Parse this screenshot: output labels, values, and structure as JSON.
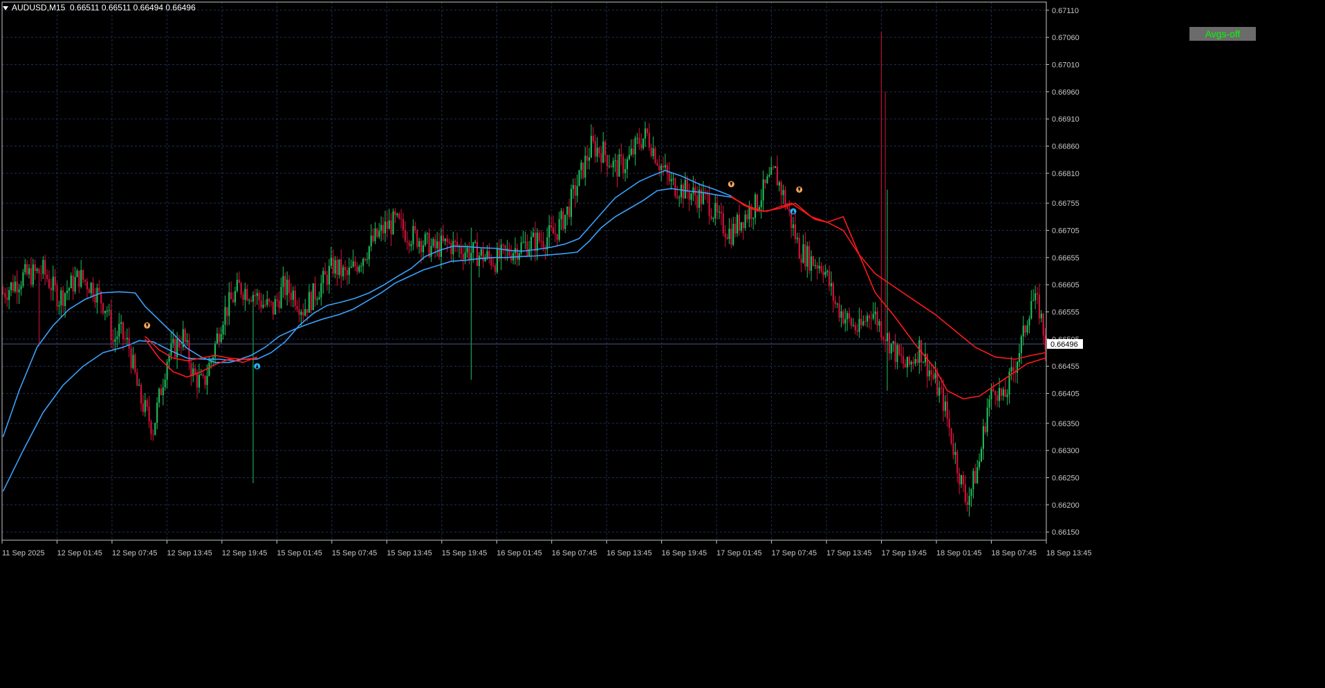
{
  "header": {
    "symbol": "AUDUSD,M15",
    "ohlc": "0.66511 0.66511 0.66494 0.66496"
  },
  "avgs_button": {
    "label": "Avgs-off"
  },
  "colors": {
    "background": "#000000",
    "grid": "#1f2f57",
    "axis": "#c8c8c8",
    "bull": "#22c55e",
    "bear": "#dc143c",
    "ma_blue": "#3ba3ff",
    "ma_red": "#ff1a1a",
    "arrow_down": "#f2a65a",
    "arrow_up": "#28b4ff",
    "price_line": "#4a5a8a"
  },
  "chart_data": {
    "type": "candlestick",
    "title": "AUDUSD,M15",
    "ylim": [
      0.66135,
      0.67125
    ],
    "grid": true,
    "current_price": "0.66496",
    "y_ticks": [
      "0.67110",
      "0.67060",
      "0.67010",
      "0.66960",
      "0.66910",
      "0.66860",
      "0.66810",
      "0.66755",
      "0.66705",
      "0.66655",
      "0.66605",
      "0.66555",
      "0.66505",
      "0.66455",
      "0.66405",
      "0.66350",
      "0.66300",
      "0.66250",
      "0.66200",
      "0.66150"
    ],
    "x_ticks": [
      "11 Sep 2025",
      "12 Sep 01:45",
      "12 Sep 07:45",
      "12 Sep 13:45",
      "12 Sep 19:45",
      "15 Sep 01:45",
      "15 Sep 07:45",
      "15 Sep 13:45",
      "15 Sep 19:45",
      "16 Sep 01:45",
      "16 Sep 07:45",
      "16 Sep 13:45",
      "16 Sep 19:45",
      "17 Sep 01:45",
      "17 Sep 07:45",
      "17 Sep 13:45",
      "17 Sep 19:45",
      "18 Sep 01:45",
      "18 Sep 07:45",
      "18 Sep 13:45"
    ],
    "price_path": [
      [
        0,
        0.6659
      ],
      [
        10,
        0.6662
      ],
      [
        20,
        0.6663
      ],
      [
        28,
        0.6658
      ],
      [
        38,
        0.6662
      ],
      [
        45,
        0.666
      ],
      [
        52,
        0.6656
      ],
      [
        55,
        0.665
      ],
      [
        58,
        0.6652
      ],
      [
        63,
        0.6649
      ],
      [
        68,
        0.664
      ],
      [
        75,
        0.6634
      ],
      [
        82,
        0.6647
      ],
      [
        90,
        0.6651
      ],
      [
        95,
        0.6644
      ],
      [
        100,
        0.6642
      ],
      [
        105,
        0.6648
      ],
      [
        110,
        0.6655
      ],
      [
        118,
        0.666
      ],
      [
        125,
        0.6659
      ],
      [
        130,
        0.6657
      ],
      [
        135,
        0.6656
      ],
      [
        140,
        0.666
      ],
      [
        145,
        0.6659
      ],
      [
        150,
        0.6656
      ],
      [
        160,
        0.6661
      ],
      [
        165,
        0.6664
      ],
      [
        172,
        0.6662
      ],
      [
        180,
        0.6666
      ],
      [
        186,
        0.6669
      ],
      [
        191,
        0.6671
      ],
      [
        196,
        0.6672
      ],
      [
        202,
        0.667
      ],
      [
        208,
        0.6669
      ],
      [
        215,
        0.6667
      ],
      [
        222,
        0.6668
      ],
      [
        230,
        0.6667
      ],
      [
        238,
        0.6666
      ],
      [
        246,
        0.6665
      ],
      [
        255,
        0.6667
      ],
      [
        262,
        0.6668
      ],
      [
        270,
        0.6669
      ],
      [
        276,
        0.667
      ],
      [
        282,
        0.6674
      ],
      [
        288,
        0.668
      ],
      [
        294,
        0.6686
      ],
      [
        300,
        0.6685
      ],
      [
        306,
        0.6682
      ],
      [
        312,
        0.6683
      ],
      [
        318,
        0.6687
      ],
      [
        322,
        0.6688
      ],
      [
        328,
        0.6683
      ],
      [
        334,
        0.6679
      ],
      [
        340,
        0.6678
      ],
      [
        346,
        0.6677
      ],
      [
        352,
        0.6676
      ],
      [
        358,
        0.6672
      ],
      [
        364,
        0.667
      ],
      [
        370,
        0.6673
      ],
      [
        376,
        0.6675
      ],
      [
        382,
        0.6679
      ],
      [
        386,
        0.6681
      ],
      [
        390,
        0.6677
      ],
      [
        394,
        0.6672
      ],
      [
        398,
        0.6667
      ],
      [
        404,
        0.6665
      ],
      [
        410,
        0.6664
      ],
      [
        416,
        0.6657
      ],
      [
        422,
        0.6654
      ],
      [
        428,
        0.6652
      ],
      [
        434,
        0.6656
      ],
      [
        440,
        0.6652
      ],
      [
        446,
        0.6648
      ],
      [
        452,
        0.6645
      ],
      [
        458,
        0.6649
      ],
      [
        464,
        0.6644
      ],
      [
        470,
        0.6639
      ],
      [
        476,
        0.6629
      ],
      [
        481,
        0.6621
      ],
      [
        484,
        0.6623
      ],
      [
        488,
        0.6628
      ],
      [
        492,
        0.6638
      ],
      [
        496,
        0.6642
      ],
      [
        500,
        0.6639
      ],
      [
        506,
        0.6646
      ],
      [
        510,
        0.6651
      ],
      [
        514,
        0.6658
      ],
      [
        518,
        0.6656
      ],
      [
        521,
        0.665
      ]
    ],
    "spikes": [
      {
        "bar": 18,
        "high": 0.6657,
        "low": 0.66492
      },
      {
        "bar": 125,
        "high": 0.6654,
        "low": 0.6624
      },
      {
        "bar": 234,
        "high": 0.6671,
        "low": 0.6643
      },
      {
        "bar": 439,
        "high": 0.6707,
        "low": 0.666
      },
      {
        "bar": 441,
        "high": 0.6696,
        "low": 0.665
      },
      {
        "bar": 442,
        "high": 0.6678,
        "low": 0.6641
      }
    ],
    "series": [
      {
        "role": "fast_ma",
        "points": [
          [
            0,
            0.66325
          ],
          [
            8,
            0.6641
          ],
          [
            17,
            0.6649
          ],
          [
            25,
            0.6653
          ],
          [
            33,
            0.6656
          ],
          [
            41,
            0.66578
          ],
          [
            49,
            0.6659
          ],
          [
            58,
            0.66592
          ],
          [
            66,
            0.6659
          ],
          [
            71,
            0.66565
          ],
          [
            78,
            0.6654
          ],
          [
            85,
            0.66515
          ],
          [
            92,
            0.66488
          ],
          [
            99,
            0.66472
          ],
          [
            106,
            0.66462
          ],
          [
            113,
            0.66462
          ],
          [
            120,
            0.66468
          ],
          [
            127,
            0.66468
          ],
          [
            134,
            0.6648
          ],
          [
            141,
            0.665
          ],
          [
            148,
            0.6653
          ],
          [
            155,
            0.66552
          ],
          [
            162,
            0.66567
          ],
          [
            169,
            0.66573
          ],
          [
            176,
            0.6658
          ],
          [
            183,
            0.6659
          ],
          [
            190,
            0.66604
          ],
          [
            197,
            0.6662
          ],
          [
            204,
            0.66635
          ],
          [
            211,
            0.66657
          ],
          [
            218,
            0.66668
          ],
          [
            225,
            0.66676
          ],
          [
            232,
            0.66675
          ],
          [
            239,
            0.66673
          ],
          [
            246,
            0.66672
          ],
          [
            253,
            0.66668
          ],
          [
            260,
            0.66667
          ],
          [
            267,
            0.6667
          ],
          [
            274,
            0.66674
          ],
          [
            281,
            0.6668
          ],
          [
            288,
            0.6669
          ],
          [
            294,
            0.66715
          ],
          [
            300,
            0.6674
          ],
          [
            306,
            0.66765
          ],
          [
            312,
            0.6678
          ],
          [
            318,
            0.66795
          ],
          [
            324,
            0.66805
          ],
          [
            331,
            0.66815
          ],
          [
            339,
            0.66805
          ],
          [
            348,
            0.6679
          ],
          [
            356,
            0.6678
          ],
          [
            364,
            0.66768
          ]
        ]
      },
      {
        "role": "slow_ma",
        "points": [
          [
            0,
            0.66225
          ],
          [
            10,
            0.663
          ],
          [
            20,
            0.6637
          ],
          [
            30,
            0.6642
          ],
          [
            40,
            0.66455
          ],
          [
            50,
            0.6648
          ],
          [
            60,
            0.6649
          ],
          [
            68,
            0.66502
          ],
          [
            75,
            0.665
          ],
          [
            83,
            0.66485
          ],
          [
            92,
            0.6647
          ],
          [
            100,
            0.66468
          ],
          [
            108,
            0.66468
          ],
          [
            116,
            0.66465
          ],
          [
            124,
            0.66475
          ],
          [
            131,
            0.6649
          ],
          [
            138,
            0.6651
          ],
          [
            145,
            0.66522
          ],
          [
            152,
            0.66532
          ],
          [
            160,
            0.66542
          ],
          [
            168,
            0.6655
          ],
          [
            175,
            0.6656
          ],
          [
            182,
            0.66575
          ],
          [
            189,
            0.6659
          ],
          [
            196,
            0.66608
          ],
          [
            203,
            0.6662
          ],
          [
            210,
            0.66632
          ],
          [
            217,
            0.6664
          ],
          [
            224,
            0.66648
          ],
          [
            231,
            0.6665
          ],
          [
            238,
            0.66653
          ],
          [
            245,
            0.66655
          ],
          [
            252,
            0.66655
          ],
          [
            259,
            0.66657
          ],
          [
            266,
            0.66658
          ],
          [
            273,
            0.6666
          ],
          [
            280,
            0.66662
          ],
          [
            287,
            0.66665
          ],
          [
            293,
            0.66685
          ],
          [
            299,
            0.6671
          ],
          [
            306,
            0.6673
          ],
          [
            313,
            0.66745
          ],
          [
            320,
            0.6676
          ],
          [
            327,
            0.66778
          ],
          [
            334,
            0.66782
          ],
          [
            341,
            0.66778
          ],
          [
            349,
            0.66775
          ],
          [
            357,
            0.6677
          ],
          [
            364,
            0.66766
          ]
        ]
      },
      {
        "role": "fast_ma_bear",
        "points": [
          [
            71,
            0.6651
          ],
          [
            78,
            0.66485
          ],
          [
            85,
            0.6647
          ],
          [
            92,
            0.66465
          ],
          [
            99,
            0.6647
          ],
          [
            106,
            0.66475
          ],
          [
            113,
            0.6647
          ],
          [
            120,
            0.66468
          ],
          [
            127,
            0.6647
          ],
          [
            364,
            0.66768
          ],
          [
            370,
            0.66752
          ],
          [
            376,
            0.66742
          ],
          [
            382,
            0.6674
          ],
          [
            388,
            0.66748
          ],
          [
            394,
            0.66755
          ],
          [
            400,
            0.6674
          ],
          [
            406,
            0.66725
          ],
          [
            412,
            0.6672
          ],
          [
            420,
            0.6673
          ],
          [
            428,
            0.6666
          ],
          [
            436,
            0.6659
          ],
          [
            446,
            0.66545
          ],
          [
            456,
            0.66495
          ],
          [
            466,
            0.6645
          ],
          [
            472,
            0.6641
          ],
          [
            480,
            0.66395
          ],
          [
            488,
            0.664
          ],
          [
            496,
            0.6642
          ],
          [
            504,
            0.6644
          ],
          [
            512,
            0.6646
          ],
          [
            521,
            0.6647
          ]
        ]
      },
      {
        "role": "slow_ma_bear",
        "points": [
          [
            71,
            0.66505
          ],
          [
            78,
            0.6647
          ],
          [
            85,
            0.66445
          ],
          [
            92,
            0.66435
          ],
          [
            99,
            0.66445
          ],
          [
            106,
            0.66458
          ],
          [
            113,
            0.66468
          ],
          [
            120,
            0.66462
          ],
          [
            127,
            0.66472
          ],
          [
            364,
            0.66766
          ],
          [
            372,
            0.6675
          ],
          [
            380,
            0.6674
          ],
          [
            388,
            0.66745
          ],
          [
            396,
            0.66755
          ],
          [
            404,
            0.6673
          ],
          [
            412,
            0.6672
          ],
          [
            420,
            0.66705
          ],
          [
            428,
            0.6666
          ],
          [
            436,
            0.66625
          ],
          [
            446,
            0.666
          ],
          [
            456,
            0.66575
          ],
          [
            466,
            0.6655
          ],
          [
            476,
            0.6652
          ],
          [
            486,
            0.6649
          ],
          [
            496,
            0.66472
          ],
          [
            506,
            0.66468
          ],
          [
            514,
            0.66475
          ],
          [
            521,
            0.6648
          ]
        ]
      }
    ],
    "signals": [
      {
        "bar": 72,
        "price": 0.6653,
        "dir": "down"
      },
      {
        "bar": 127,
        "price": 0.66455,
        "dir": "up"
      },
      {
        "bar": 364,
        "price": 0.6679,
        "dir": "down"
      },
      {
        "bar": 398,
        "price": 0.6678,
        "dir": "down"
      },
      {
        "bar": 395,
        "price": 0.6674,
        "dir": "up"
      }
    ]
  }
}
